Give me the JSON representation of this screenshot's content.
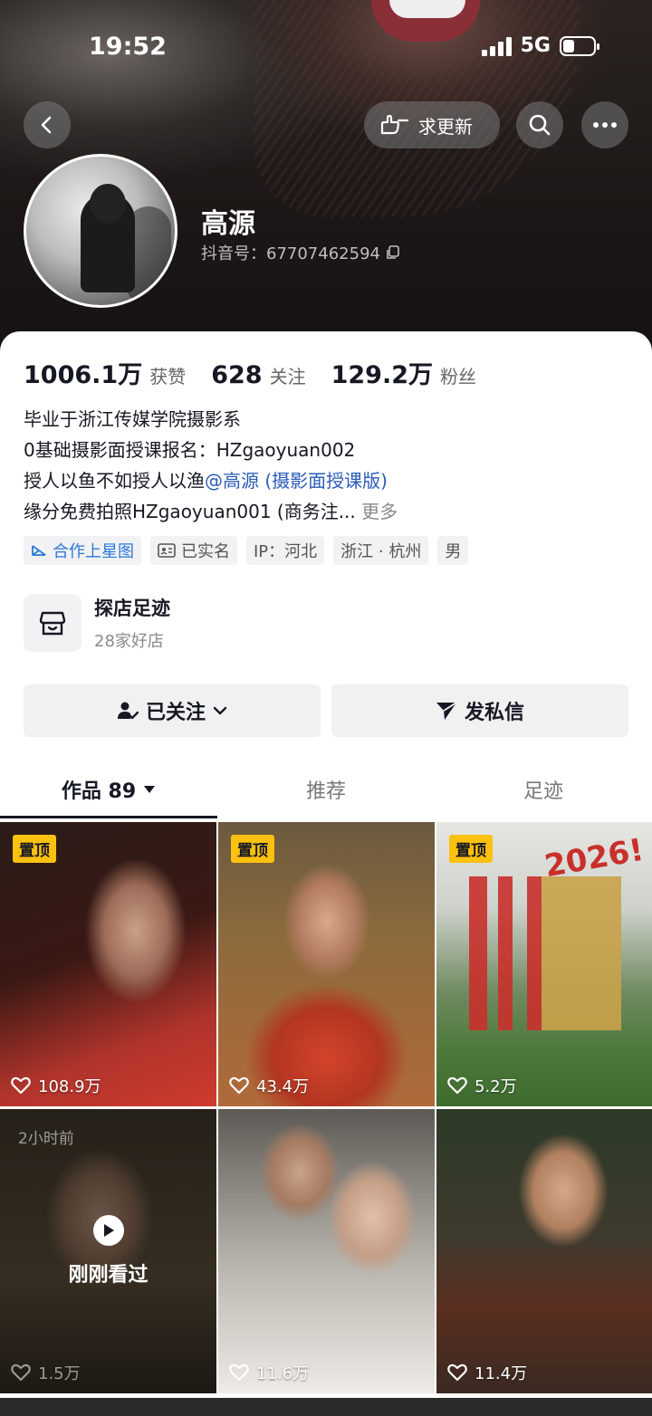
{
  "status_bar": {
    "time": "19:52",
    "network": "5G"
  },
  "header": {
    "request_update_label": "求更新"
  },
  "profile": {
    "name": "高源",
    "douyin_id": "抖音号：67707462594",
    "stats": [
      {
        "value": "1006.1万",
        "label": "获赞"
      },
      {
        "value": "628",
        "label": "关注"
      },
      {
        "value": "129.2万",
        "label": "粉丝"
      }
    ],
    "bio": {
      "line1": "毕业于浙江传媒学院摄影系",
      "line2": "0基础摄影面授课报名：HZgaoyuan002",
      "line3_text": "授人以鱼不如授人以渔",
      "line3_mention": "@高源 (摄影面授课版)",
      "line4_text": "缘分免费拍照HZgaoyuan001 (商务注...",
      "line4_more": "更多"
    },
    "tags": [
      "合作上星图",
      "已实名",
      "IP：河北",
      "浙江 · 杭州",
      "男"
    ]
  },
  "shop": {
    "title": "探店足迹",
    "subtitle": "28家好店"
  },
  "actions": {
    "followed_label": "已关注",
    "message_label": "发私信"
  },
  "tabs": [
    {
      "label": "作品 89"
    },
    {
      "label": "推荐"
    },
    {
      "label": "足迹"
    }
  ],
  "videos": [
    {
      "pinned": "置顶",
      "likes": "108.9万"
    },
    {
      "pinned": "置顶",
      "likes": "43.4万"
    },
    {
      "pinned": "置顶",
      "likes": "5.2万",
      "overlay_text": "2026!"
    },
    {
      "ago": "2小时前",
      "viewed": "刚刚看过",
      "likes": "1.5万"
    },
    {
      "likes": "11.6万"
    },
    {
      "likes": "11.4万"
    }
  ],
  "colors": {
    "mention": "#2a5bb8",
    "pin_badge": "#fcc10f",
    "star_tag": "#2a7ad8"
  }
}
